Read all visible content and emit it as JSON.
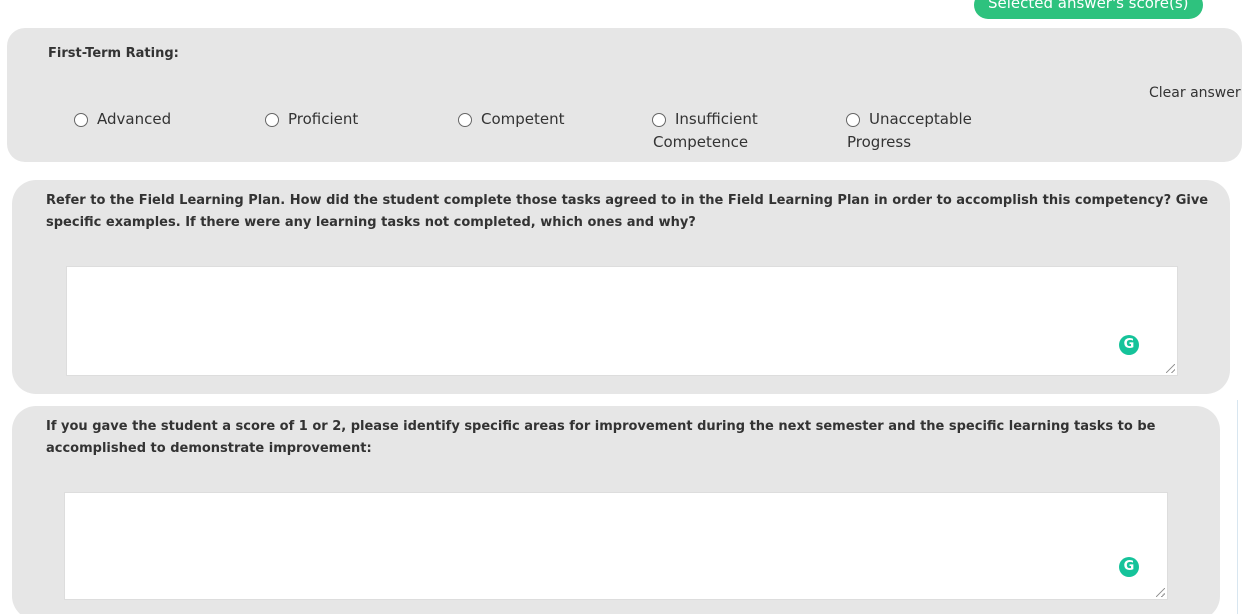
{
  "score_badge": "Selected answer's score(s)",
  "rating": {
    "label": "First-Term Rating:",
    "clear_label": "Clear answer",
    "options": [
      {
        "line1": "Advanced",
        "line2": ""
      },
      {
        "line1": "Proficient",
        "line2": ""
      },
      {
        "line1": "Competent",
        "line2": ""
      },
      {
        "line1": "Insufficient",
        "line2": "Competence"
      },
      {
        "line1": "Unacceptable",
        "line2": "Progress"
      }
    ]
  },
  "questions": [
    {
      "text": "Refer to the Field Learning Plan. How did the student complete those tasks agreed to in the Field Learning Plan in order to accomplish this competency? Give specific examples. If there were any learning tasks not completed, which ones and why?",
      "answer": ""
    },
    {
      "text": "If you gave the student a score of 1 or 2, please identify specific areas for improvement during the next semester and the specific learning tasks to be accomplished to demonstrate improvement:",
      "answer": ""
    }
  ],
  "icons": {
    "grammarly": "grammarly-icon",
    "grammarly_glyph": "G"
  },
  "colors": {
    "card_bg": "#e6e6e6",
    "accent_green": "#2ec27e",
    "grammarly_green": "#15c39a"
  }
}
